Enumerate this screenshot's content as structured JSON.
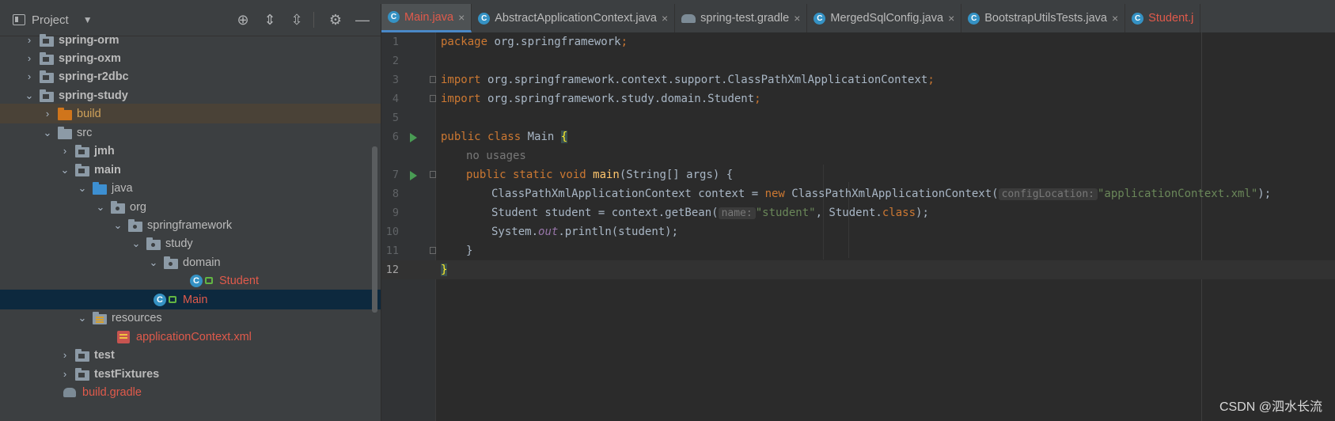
{
  "project_panel": {
    "title": "Project",
    "tools": [
      "locate-icon",
      "expand-all-icon",
      "collapse-all-icon",
      "gear-icon",
      "hide-icon"
    ],
    "tree": [
      {
        "label": "spring-orm",
        "expanded": false,
        "kind": "module",
        "bold": true
      },
      {
        "label": "spring-oxm",
        "expanded": false,
        "kind": "module",
        "bold": true
      },
      {
        "label": "spring-r2dbc",
        "expanded": false,
        "kind": "module",
        "bold": true
      },
      {
        "label": "spring-study",
        "expanded": true,
        "kind": "module",
        "bold": true
      },
      {
        "label": "build",
        "expanded": false,
        "kind": "excluded"
      },
      {
        "label": "src",
        "expanded": true,
        "kind": "folder"
      },
      {
        "label": "jmh",
        "expanded": false,
        "kind": "module",
        "bold": true
      },
      {
        "label": "main",
        "expanded": true,
        "kind": "module",
        "bold": true
      },
      {
        "label": "java",
        "expanded": true,
        "kind": "source"
      },
      {
        "label": "org",
        "expanded": true,
        "kind": "package"
      },
      {
        "label": "springframework",
        "expanded": true,
        "kind": "package"
      },
      {
        "label": "study",
        "expanded": true,
        "kind": "package"
      },
      {
        "label": "domain",
        "expanded": true,
        "kind": "package"
      },
      {
        "label": "Student",
        "kind": "class"
      },
      {
        "label": "Main",
        "kind": "class"
      },
      {
        "label": "resources",
        "expanded": true,
        "kind": "resources"
      },
      {
        "label": "applicationContext.xml",
        "kind": "xml"
      },
      {
        "label": "test",
        "expanded": false,
        "kind": "module",
        "bold": true
      },
      {
        "label": "testFixtures",
        "expanded": false,
        "kind": "module",
        "bold": true
      },
      {
        "label": "build.gradle",
        "kind": "gradle"
      }
    ]
  },
  "tabs": [
    {
      "label": "Main.java",
      "active": true
    },
    {
      "label": "AbstractApplicationContext.java"
    },
    {
      "label": "spring-test.gradle"
    },
    {
      "label": "MergedSqlConfig.java"
    },
    {
      "label": "BootstrapUtilsTests.java"
    },
    {
      "label": "Student.j"
    }
  ],
  "editor": {
    "line_numbers": [
      "1",
      "2",
      "3",
      "4",
      "5",
      "6",
      "",
      "7",
      "8",
      "9",
      "10",
      "11",
      "12"
    ],
    "pkg_kw": "package",
    "pkg_name": " org.springframework",
    "import_kw": "import",
    "import1": " org.springframework.context.support.ClassPathXmlApplicationContext",
    "import2": " org.springframework.study.domain.Student",
    "semi": ";",
    "public_class": "public class",
    "class_name": " Main ",
    "open_brace": "{",
    "no_usages": "no usages",
    "public_static_void": "public static void",
    "main_name": " main",
    "main_params": "(String[] args) {",
    "line8_a": "ClassPathXmlApplicationContext context = ",
    "new_kw": "new",
    "line8_b": " ClassPathXmlApplicationContext(",
    "hint_configLocation": "configLocation:",
    "str_appctx": "\"applicationContext.xml\"",
    "line8_end": ");",
    "line9_a": "Student student = context.getBean(",
    "hint_name": "name:",
    "str_student": "\"student\"",
    "line9_b": ", Student.",
    "class_kw": "class",
    "line9_end": ");",
    "line10_a": "System.",
    "out": "out",
    "line10_b": ".println(student);",
    "close_brace": "}",
    "close_brace_final": "}"
  },
  "watermark": "CSDN @泗水长流"
}
